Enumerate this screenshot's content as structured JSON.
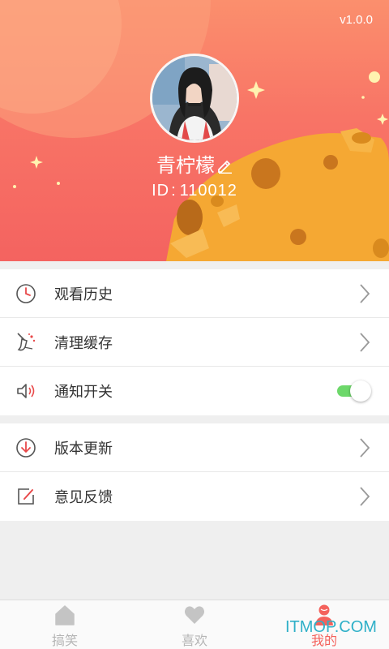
{
  "profile": {
    "version": "v1.0.0",
    "nickname": "青柠檬",
    "id_label": "ID",
    "id_separator": ":",
    "id_value": "110012"
  },
  "menu": {
    "group1": [
      {
        "label": "观看历史",
        "icon": "clock-icon",
        "control": "arrow"
      },
      {
        "label": "清理缓存",
        "icon": "broom-icon",
        "control": "arrow"
      },
      {
        "label": "通知开关",
        "icon": "speaker-icon",
        "control": "toggle",
        "toggle_on": true
      }
    ],
    "group2": [
      {
        "label": "版本更新",
        "icon": "download-circle-icon",
        "control": "arrow"
      },
      {
        "label": "意见反馈",
        "icon": "feedback-edit-icon",
        "control": "arrow"
      }
    ]
  },
  "bottom_nav": {
    "items": [
      {
        "label": "搞笑",
        "icon": "house-icon",
        "active": false
      },
      {
        "label": "喜欢",
        "icon": "heart-icon",
        "active": false
      },
      {
        "label": "我的",
        "icon": "person-icon",
        "active": true
      }
    ]
  },
  "watermark": "ITMOP.COM",
  "colors": {
    "header_top": "#fb8f6d",
    "header_bottom": "#f46360",
    "cheese": "#f4a531",
    "accent": "#f4625c",
    "toggle_on": "#6dd86a",
    "inactive_nav": "#b5b5b5"
  }
}
